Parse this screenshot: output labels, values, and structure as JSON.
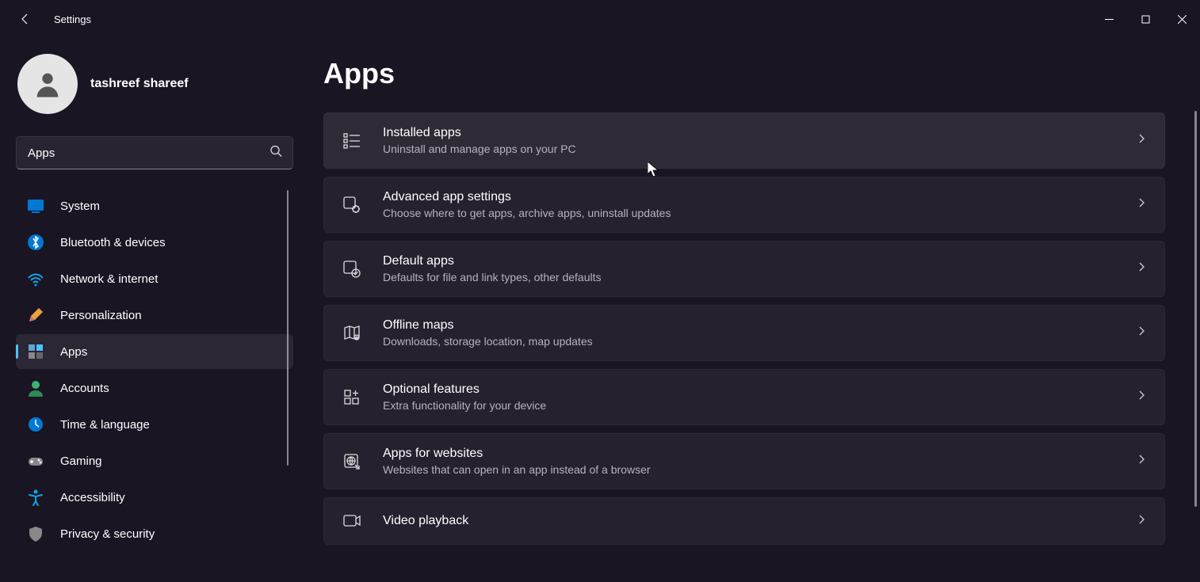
{
  "window": {
    "title": "Settings"
  },
  "user": {
    "name": "tashreef shareef"
  },
  "search": {
    "value": "Apps"
  },
  "nav": {
    "items": [
      {
        "id": "system",
        "label": "System"
      },
      {
        "id": "bluetooth",
        "label": "Bluetooth & devices"
      },
      {
        "id": "network",
        "label": "Network & internet"
      },
      {
        "id": "personalization",
        "label": "Personalization"
      },
      {
        "id": "apps",
        "label": "Apps"
      },
      {
        "id": "accounts",
        "label": "Accounts"
      },
      {
        "id": "time",
        "label": "Time & language"
      },
      {
        "id": "gaming",
        "label": "Gaming"
      },
      {
        "id": "accessibility",
        "label": "Accessibility"
      },
      {
        "id": "privacy",
        "label": "Privacy & security"
      }
    ],
    "active": "apps"
  },
  "page": {
    "title": "Apps",
    "cards": [
      {
        "id": "installed",
        "icon": "list-icon",
        "title": "Installed apps",
        "desc": "Uninstall and manage apps on your PC"
      },
      {
        "id": "advanced",
        "icon": "app-gear-icon",
        "title": "Advanced app settings",
        "desc": "Choose where to get apps, archive apps, uninstall updates"
      },
      {
        "id": "default",
        "icon": "app-check-icon",
        "title": "Default apps",
        "desc": "Defaults for file and link types, other defaults"
      },
      {
        "id": "offlinemaps",
        "icon": "map-icon",
        "title": "Offline maps",
        "desc": "Downloads, storage location, map updates"
      },
      {
        "id": "optional",
        "icon": "app-plus-icon",
        "title": "Optional features",
        "desc": "Extra functionality for your device"
      },
      {
        "id": "appsforweb",
        "icon": "globe-arrow-icon",
        "title": "Apps for websites",
        "desc": "Websites that can open in an app instead of a browser"
      },
      {
        "id": "video",
        "icon": "video-icon",
        "title": "Video playback",
        "desc": ""
      }
    ]
  }
}
